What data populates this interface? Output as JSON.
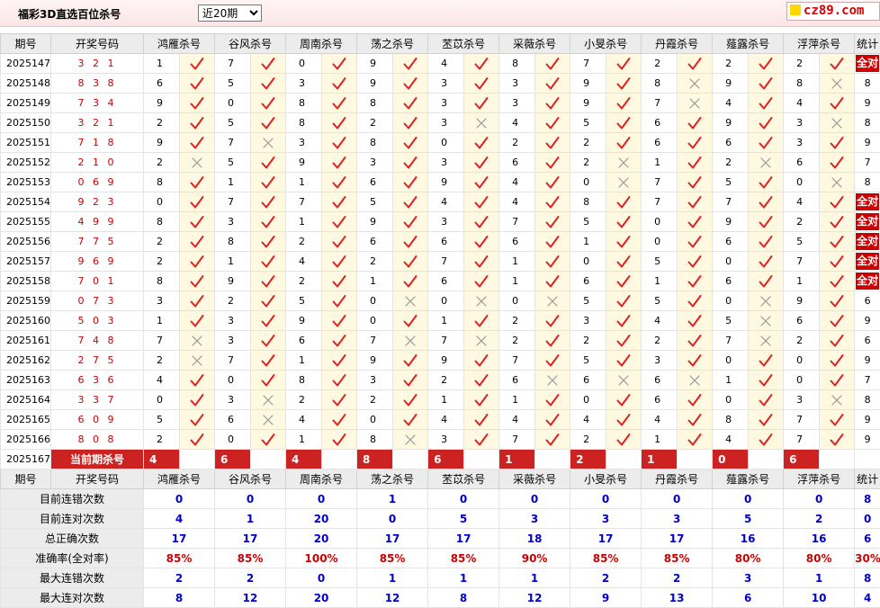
{
  "header": {
    "title": "福彩3D直选百位杀号",
    "period_option": "近20期",
    "logo_text": "cz89.com"
  },
  "columns": {
    "issue": "期号",
    "win": "开奖号码",
    "experts": [
      "鸿雁杀号",
      "谷风杀号",
      "周南杀号",
      "荡之杀号",
      "苤苡杀号",
      "采薇杀号",
      "小旻杀号",
      "丹霞杀号",
      "薤露杀号",
      "浮萍杀号"
    ],
    "stats": "统计"
  },
  "rows": [
    {
      "issue": "2025147",
      "win": "3 2 1",
      "picks": [
        "1",
        "7",
        "0",
        "9",
        "4",
        "8",
        "7",
        "2",
        "2",
        "2"
      ],
      "hits": [
        1,
        1,
        1,
        1,
        1,
        1,
        1,
        1,
        1,
        1
      ],
      "stat": "全对"
    },
    {
      "issue": "2025148",
      "win": "8 3 8",
      "picks": [
        "6",
        "5",
        "3",
        "9",
        "3",
        "3",
        "9",
        "8",
        "9",
        "8"
      ],
      "hits": [
        1,
        1,
        1,
        1,
        1,
        1,
        1,
        0,
        1,
        0
      ],
      "stat": "8"
    },
    {
      "issue": "2025149",
      "win": "7 3 4",
      "picks": [
        "9",
        "0",
        "8",
        "8",
        "3",
        "3",
        "9",
        "7",
        "4",
        "4"
      ],
      "hits": [
        1,
        1,
        1,
        1,
        1,
        1,
        1,
        0,
        1,
        1
      ],
      "stat": "9"
    },
    {
      "issue": "2025150",
      "win": "3 2 1",
      "picks": [
        "2",
        "5",
        "8",
        "2",
        "3",
        "4",
        "5",
        "6",
        "9",
        "3"
      ],
      "hits": [
        1,
        1,
        1,
        1,
        0,
        1,
        1,
        1,
        1,
        0
      ],
      "stat": "8"
    },
    {
      "issue": "2025151",
      "win": "7 1 8",
      "picks": [
        "9",
        "7",
        "3",
        "8",
        "0",
        "2",
        "2",
        "6",
        "6",
        "3"
      ],
      "hits": [
        1,
        0,
        1,
        1,
        1,
        1,
        1,
        1,
        1,
        1
      ],
      "stat": "9"
    },
    {
      "issue": "2025152",
      "win": "2 1 0",
      "picks": [
        "2",
        "5",
        "9",
        "3",
        "3",
        "6",
        "2",
        "1",
        "2",
        "6"
      ],
      "hits": [
        0,
        1,
        1,
        1,
        1,
        1,
        0,
        1,
        0,
        1
      ],
      "stat": "7"
    },
    {
      "issue": "2025153",
      "win": "0 6 9",
      "picks": [
        "8",
        "1",
        "1",
        "6",
        "9",
        "4",
        "0",
        "7",
        "5",
        "0"
      ],
      "hits": [
        1,
        1,
        1,
        1,
        1,
        1,
        0,
        1,
        1,
        0
      ],
      "stat": "8"
    },
    {
      "issue": "2025154",
      "win": "9 2 3",
      "picks": [
        "0",
        "7",
        "7",
        "5",
        "4",
        "4",
        "8",
        "7",
        "7",
        "4"
      ],
      "hits": [
        1,
        1,
        1,
        1,
        1,
        1,
        1,
        1,
        1,
        1
      ],
      "stat": "全对"
    },
    {
      "issue": "2025155",
      "win": "4 9 9",
      "picks": [
        "8",
        "3",
        "1",
        "9",
        "3",
        "7",
        "5",
        "0",
        "9",
        "2"
      ],
      "hits": [
        1,
        1,
        1,
        1,
        1,
        1,
        1,
        1,
        1,
        1
      ],
      "stat": "全对"
    },
    {
      "issue": "2025156",
      "win": "7 7 5",
      "picks": [
        "2",
        "8",
        "2",
        "6",
        "6",
        "6",
        "1",
        "0",
        "6",
        "5"
      ],
      "hits": [
        1,
        1,
        1,
        1,
        1,
        1,
        1,
        1,
        1,
        1
      ],
      "stat": "全对"
    },
    {
      "issue": "2025157",
      "win": "9 6 9",
      "picks": [
        "2",
        "1",
        "4",
        "2",
        "7",
        "1",
        "0",
        "5",
        "0",
        "7"
      ],
      "hits": [
        1,
        1,
        1,
        1,
        1,
        1,
        1,
        1,
        1,
        1
      ],
      "stat": "全对"
    },
    {
      "issue": "2025158",
      "win": "7 0 1",
      "picks": [
        "8",
        "9",
        "2",
        "1",
        "6",
        "1",
        "6",
        "1",
        "6",
        "1"
      ],
      "hits": [
        1,
        1,
        1,
        1,
        1,
        1,
        1,
        1,
        1,
        1
      ],
      "stat": "全对"
    },
    {
      "issue": "2025159",
      "win": "0 7 3",
      "picks": [
        "3",
        "2",
        "5",
        "0",
        "0",
        "0",
        "5",
        "5",
        "0",
        "9"
      ],
      "hits": [
        1,
        1,
        1,
        0,
        0,
        0,
        1,
        1,
        0,
        1
      ],
      "stat": "6"
    },
    {
      "issue": "2025160",
      "win": "5 0 3",
      "picks": [
        "1",
        "3",
        "9",
        "0",
        "1",
        "2",
        "3",
        "4",
        "5",
        "6"
      ],
      "hits": [
        1,
        1,
        1,
        1,
        1,
        1,
        1,
        1,
        0,
        1
      ],
      "stat": "9"
    },
    {
      "issue": "2025161",
      "win": "7 4 8",
      "picks": [
        "7",
        "3",
        "6",
        "7",
        "7",
        "2",
        "2",
        "2",
        "7",
        "2"
      ],
      "hits": [
        0,
        1,
        1,
        0,
        0,
        1,
        1,
        1,
        0,
        1
      ],
      "stat": "6"
    },
    {
      "issue": "2025162",
      "win": "2 7 5",
      "picks": [
        "2",
        "7",
        "1",
        "9",
        "9",
        "7",
        "5",
        "3",
        "0",
        "0"
      ],
      "hits": [
        0,
        1,
        1,
        1,
        1,
        1,
        1,
        1,
        1,
        1
      ],
      "stat": "9"
    },
    {
      "issue": "2025163",
      "win": "6 3 6",
      "picks": [
        "4",
        "0",
        "8",
        "3",
        "2",
        "6",
        "6",
        "6",
        "1",
        "0"
      ],
      "hits": [
        1,
        1,
        1,
        1,
        1,
        0,
        0,
        0,
        1,
        1
      ],
      "stat": "7"
    },
    {
      "issue": "2025164",
      "win": "3 3 7",
      "picks": [
        "0",
        "3",
        "2",
        "2",
        "1",
        "1",
        "0",
        "6",
        "0",
        "3"
      ],
      "hits": [
        1,
        0,
        1,
        1,
        1,
        1,
        1,
        1,
        1,
        0
      ],
      "stat": "8"
    },
    {
      "issue": "2025165",
      "win": "6 0 9",
      "picks": [
        "5",
        "6",
        "4",
        "0",
        "4",
        "4",
        "4",
        "4",
        "8",
        "7"
      ],
      "hits": [
        1,
        0,
        1,
        1,
        1,
        1,
        1,
        1,
        1,
        1
      ],
      "stat": "9"
    },
    {
      "issue": "2025166",
      "win": "8 0 8",
      "picks": [
        "2",
        "0",
        "1",
        "8",
        "3",
        "7",
        "2",
        "1",
        "4",
        "7"
      ],
      "hits": [
        1,
        1,
        1,
        0,
        1,
        1,
        1,
        1,
        1,
        1
      ],
      "stat": "9"
    }
  ],
  "current": {
    "issue": "2025167",
    "label": "当前期杀号",
    "picks": [
      "4",
      "6",
      "4",
      "8",
      "6",
      "1",
      "2",
      "1",
      "0",
      "6"
    ]
  },
  "stats": [
    {
      "label": "目前连错次数",
      "values": [
        "0",
        "0",
        "0",
        "1",
        "0",
        "0",
        "0",
        "0",
        "0",
        "0"
      ],
      "total": "8"
    },
    {
      "label": "目前连对次数",
      "values": [
        "4",
        "1",
        "20",
        "0",
        "5",
        "3",
        "3",
        "3",
        "5",
        "2"
      ],
      "total": "0"
    },
    {
      "label": "总正确次数",
      "values": [
        "17",
        "17",
        "20",
        "17",
        "17",
        "18",
        "17",
        "17",
        "16",
        "16"
      ],
      "total": "6"
    },
    {
      "label": "准确率(全对率)",
      "values": [
        "85%",
        "85%",
        "100%",
        "85%",
        "85%",
        "90%",
        "85%",
        "85%",
        "80%",
        "80%"
      ],
      "total": "30%"
    },
    {
      "label": "最大连错次数",
      "values": [
        "2",
        "2",
        "0",
        "1",
        "1",
        "1",
        "2",
        "2",
        "3",
        "1"
      ],
      "total": "8"
    },
    {
      "label": "最大连对次数",
      "values": [
        "8",
        "12",
        "20",
        "12",
        "8",
        "12",
        "9",
        "13",
        "6",
        "10"
      ],
      "total": "4"
    }
  ],
  "colors": {
    "hit": "#d22",
    "miss": "#999",
    "badge": "#c00",
    "stat_value": "#00c",
    "header_bg": "#ececec",
    "cell_bg": "#fff9e1"
  }
}
